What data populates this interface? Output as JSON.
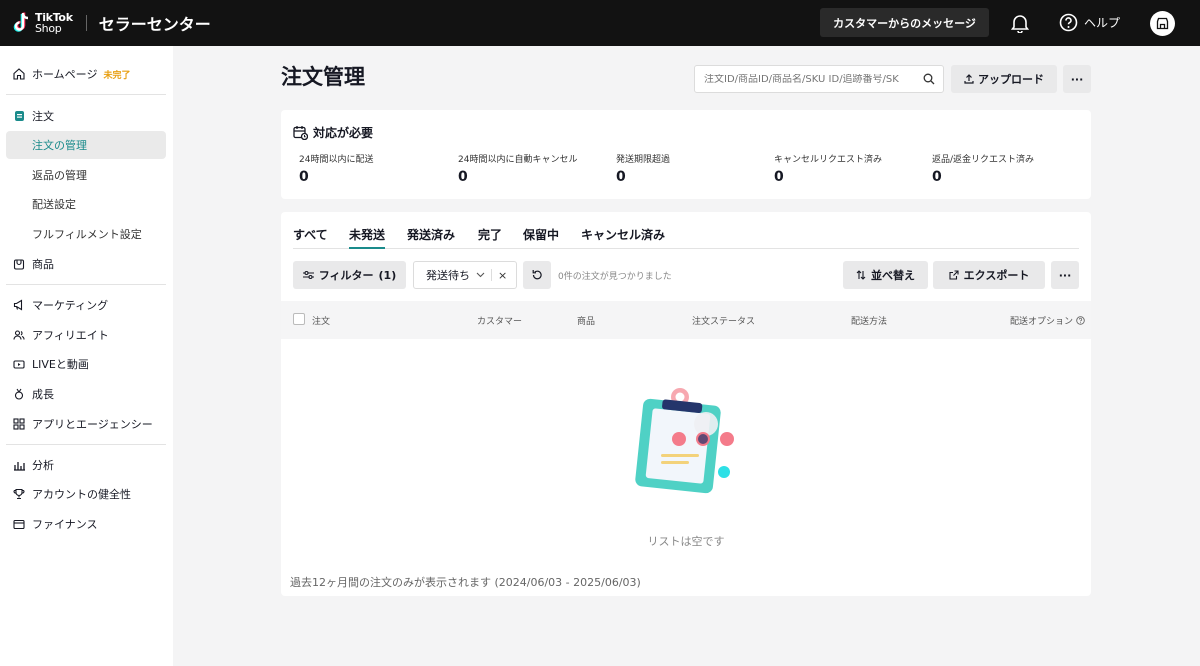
{
  "topbar": {
    "logo_line1": "TikTok",
    "logo_line2": "Shop",
    "app_title": "セラーセンター",
    "messages_button": "カスタマーからのメッセージ",
    "help_label": "ヘルプ"
  },
  "sidebar": {
    "home": {
      "label": "ホームページ",
      "badge": "未完了"
    },
    "orders": "注文",
    "order_manage": "注文の管理",
    "returns": "返品の管理",
    "shipping_settings": "配送設定",
    "fulfillment": "フルフィルメント設定",
    "products": "商品",
    "marketing": "マーケティング",
    "affiliate": "アフィリエイト",
    "live_video": "LIVEと動画",
    "growth": "成長",
    "apps": "アプリとエージェンシー",
    "analytics": "分析",
    "account_health": "アカウントの健全性",
    "finance": "ファイナンス"
  },
  "header": {
    "title": "注文管理",
    "search_placeholder": "注文ID/商品ID/商品名/SKU ID/追跡番号/SK",
    "upload_label": "アップロード",
    "more_label": "···"
  },
  "action_required": {
    "title": "対応が必要",
    "metrics": [
      {
        "label": "24時間以内に配送",
        "value": "0"
      },
      {
        "label": "24時間以内に自動キャンセル",
        "value": "0"
      },
      {
        "label": "発送期限超過",
        "value": "0"
      },
      {
        "label": "キャンセルリクエスト済み",
        "value": "0"
      },
      {
        "label": "返品/返金リクエスト済み",
        "value": "0"
      }
    ]
  },
  "tabs": [
    "すべて",
    "未発送",
    "発送済み",
    "完了",
    "保留中",
    "キャンセル済み"
  ],
  "active_tab": "未発送",
  "toolbar": {
    "filter_label": "フィルター",
    "filter_count": "(1)",
    "status_select": "発送待ち",
    "status_clear": "×",
    "result_text": "0件の注文が見つかりました",
    "sort_label": "並べ替え",
    "export_label": "エクスポート",
    "more_label": "···"
  },
  "table": {
    "columns": [
      "注文",
      "カスタマー",
      "商品",
      "注文ステータス",
      "配送方法",
      "配送オプション"
    ]
  },
  "empty_state": "リストは空です",
  "footnote": "過去12ヶ月間の注文のみが表示されます (2024/06/03 - 2025/06/03)",
  "colors": {
    "accent": "#1a8b8b",
    "topbar": "#121212",
    "incomplete": "#e8a013"
  }
}
